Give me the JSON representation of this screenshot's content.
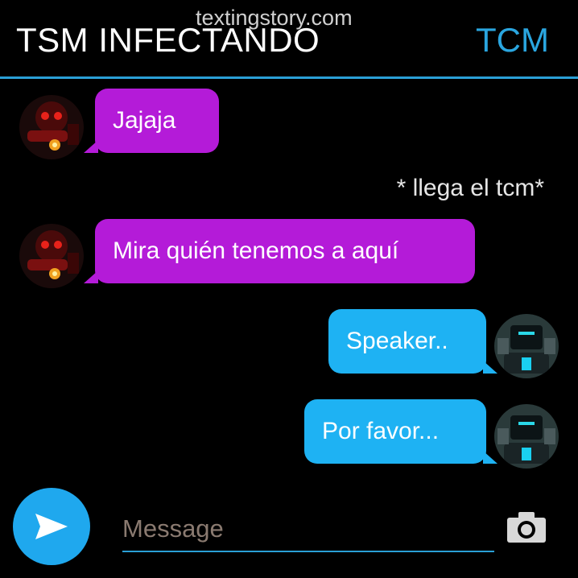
{
  "header": {
    "title": "TSM INFECTANDO",
    "contact": "TCM",
    "watermark": "textingstory.com"
  },
  "messages": [
    {
      "side": "left",
      "text": "Jajaja",
      "avatar": "red-robot-avatar"
    },
    {
      "side": "narration",
      "text": "* llega el tcm*"
    },
    {
      "side": "left",
      "text": "Mira quién tenemos a aquí",
      "avatar": "red-robot-avatar"
    },
    {
      "side": "right",
      "text": "Speaker..",
      "avatar": "tv-robot-avatar"
    },
    {
      "side": "right",
      "text": "Por favor...",
      "avatar": "tv-robot-avatar"
    }
  ],
  "composer": {
    "placeholder": "Message",
    "send_icon": "send-icon",
    "camera_icon": "camera-icon"
  },
  "colors": {
    "left_bubble": "#b41bd8",
    "right_bubble": "#1eb2f3",
    "accent": "#2a9fd6",
    "background": "#000000"
  }
}
